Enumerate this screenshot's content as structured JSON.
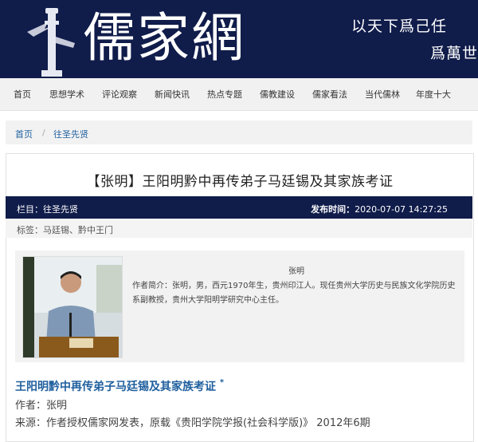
{
  "banner": {
    "logo": "儒家網",
    "slogan_line1": "以天下爲己任",
    "slogan_line2": "爲萬世"
  },
  "nav": {
    "items": [
      "首页",
      "思想学术",
      "评论观察",
      "新闻快讯",
      "热点专题",
      "儒教建设",
      "儒家看法",
      "当代儒林",
      "年度十大"
    ]
  },
  "breadcrumb": {
    "home": "首页",
    "separator": "/",
    "current": "往圣先贤"
  },
  "article": {
    "title": "【张明】王阳明黔中再传弟子马廷锡及其家族考证",
    "column": "栏目：往圣先贤",
    "publish_label": "发布时间：",
    "publish_time": "2020-07-07 14:27:25",
    "tags": "标签：马廷锡、黔中王门",
    "author_box": {
      "name": "张明",
      "bio": "作者简介：张明，男，西元1970年生，贵州印江人。现任贵州大学历史与民族文化学院历史系副教授，贵州大学阳明学研究中心主任。",
      "photo_nameplate": "张  明"
    },
    "subtitle": "王阳明黔中再传弟子马廷锡及其家族考证",
    "subtitle_mark": "*",
    "author_line": "作者：张明",
    "source_line": "来源：作者授权儒家网发表，原载《贵阳学院学报(社会科学版)》 2012年6期"
  },
  "colors": {
    "navy": "#101c4a",
    "link_blue": "#1f5f9e"
  }
}
